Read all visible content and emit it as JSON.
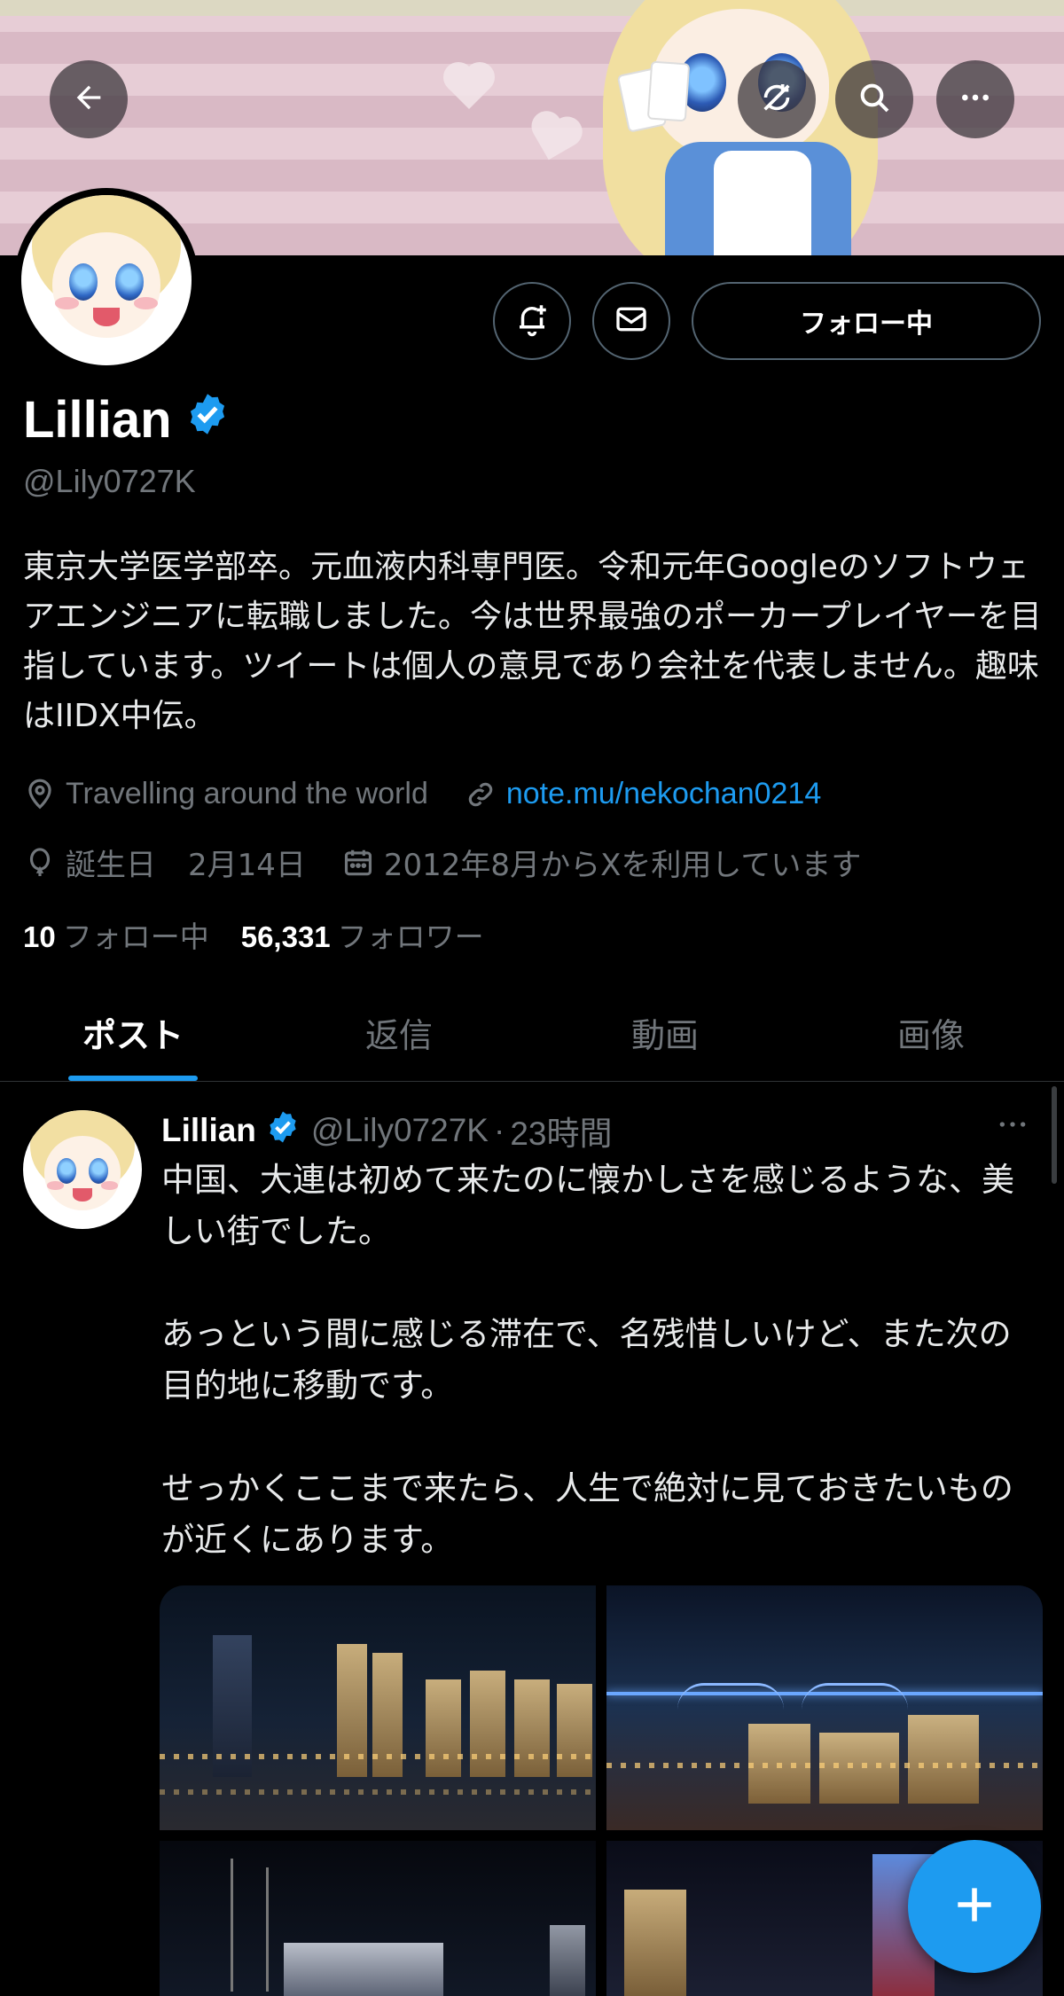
{
  "header": {
    "back_icon": "arrow-left-icon",
    "refresh_icon": "refresh-off-icon",
    "search_icon": "search-icon",
    "more_icon": "more-horizontal-icon"
  },
  "profile": {
    "name": "Lillian",
    "handle": "@Lily0727K",
    "verified_color": "#1d9bf0",
    "bio": "東京大学医学部卒。元血液内科専門医。令和元年Googleのソフトウェアエンジニアに転職しました。今は世界最強のポーカープレイヤーを目指しています。ツイートは個人の意見であり会社を代表しません。趣味はIIDX中伝。",
    "location": "Travelling around the world",
    "website": "note.mu/nekochan0214",
    "birthday_label": "誕生日",
    "birthday": "2月14日",
    "joined": "2012年8月からXを利用しています",
    "following_count": "10",
    "following_label": "フォロー中",
    "followers_count": "56,331",
    "followers_label": "フォロワー"
  },
  "actions": {
    "notify_icon": "bell-plus-icon",
    "message_icon": "mail-icon",
    "follow_label": "フォロー中"
  },
  "tabs": [
    {
      "label": "ポスト",
      "active": true
    },
    {
      "label": "返信",
      "active": false
    },
    {
      "label": "動画",
      "active": false
    },
    {
      "label": "画像",
      "active": false
    }
  ],
  "post": {
    "name": "Lillian",
    "handle": "@Lily0727K",
    "time": "23時間",
    "text": "中国、大連は初めて来たのに懐かしさを感じるような、美しい街でした。\n\nあっという間に感じる滞在で、名残惜しいけど、また次の目的地に移動です。\n\nせっかくここまで来たら、人生で絶対に見ておきたいものが近くにあります。"
  },
  "fab": {
    "icon": "plus-icon"
  },
  "colors": {
    "accent": "#1d9bf0",
    "muted": "#71767b",
    "background": "#000000"
  }
}
